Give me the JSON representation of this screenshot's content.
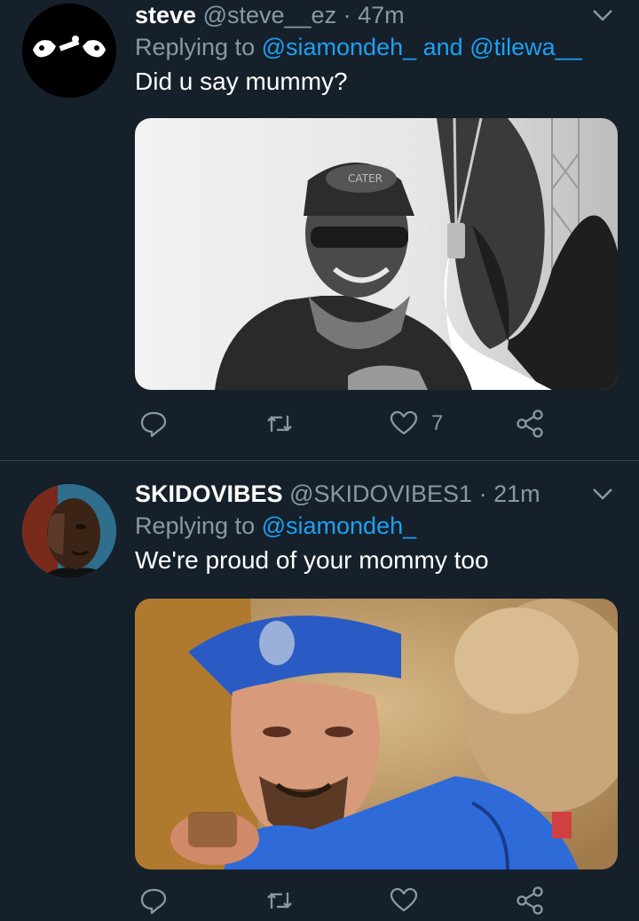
{
  "tweets": [
    {
      "name": "steve",
      "handle": "@steve__ez",
      "separator": "·",
      "time": "47m",
      "replying_prefix": "Replying to",
      "mentions": [
        "@siamondeh_",
        "@tilewa__"
      ],
      "mention_joiner": "and",
      "text": "Did u say mummy?",
      "likes": "7"
    },
    {
      "name": "SKIDOVIBES",
      "handle": "@SKIDOVIBES1",
      "separator": "·",
      "time": "21m",
      "replying_prefix": "Replying to",
      "mentions": [
        "@siamondeh_"
      ],
      "text": "We're proud of your mommy too"
    }
  ],
  "colors": {
    "background": "#15202b",
    "secondary_text": "#8899a6",
    "accent": "#1da1f2",
    "divider": "#38444d"
  },
  "icons": [
    "reply-icon",
    "retweet-icon",
    "like-icon",
    "share-icon",
    "chevron-down-icon"
  ]
}
